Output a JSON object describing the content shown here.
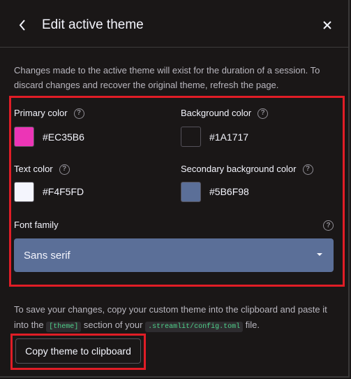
{
  "header": {
    "title": "Edit active theme",
    "back_icon": "chevron-left-icon",
    "close_icon": "close-icon"
  },
  "intro": "Changes made to the active theme will exist for the duration of a session. To discard changes and recover the original theme, refresh the page.",
  "fields": {
    "primary": {
      "label": "Primary color",
      "value": "#EC35B6",
      "color": "#EC35B6"
    },
    "background": {
      "label": "Background color",
      "value": "#1A1717",
      "color": "#1A1717"
    },
    "text": {
      "label": "Text color",
      "value": "#F4F5FD",
      "color": "#F4F5FD"
    },
    "secondary": {
      "label": "Secondary background color",
      "value": "#5B6F98",
      "color": "#5B6F98"
    }
  },
  "font": {
    "label": "Font family",
    "value": "Sans serif"
  },
  "footer": {
    "text_a": "To save your changes, copy your custom theme into the clipboard and paste it into the ",
    "code_a": "[theme]",
    "text_b": " section of your ",
    "code_b": ".streamlit/config.toml",
    "text_c": " file.",
    "copy_button": "Copy theme to clipboard"
  },
  "accent_colors": {
    "highlight_border": "#E01D26",
    "select_bg": "#5B6F98",
    "code_text": "#4FD08A"
  }
}
